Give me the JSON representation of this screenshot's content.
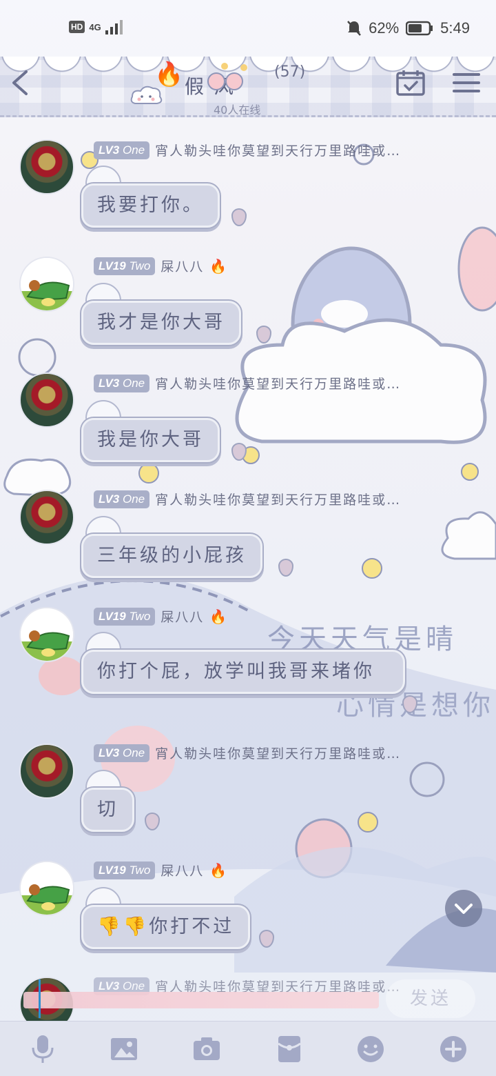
{
  "status_bar": {
    "hd": "HD",
    "network": "4G",
    "battery": "62%",
    "time": "5:49"
  },
  "header": {
    "title": "假 风",
    "member_count": "(57)",
    "online": "40人在线"
  },
  "messages": [
    {
      "level": "LV3",
      "tier": "One",
      "nickname": "宵人勒头哇你莫望到天行万里路哇或…",
      "text": "我要打你。",
      "avatar": "one"
    },
    {
      "level": "LV19",
      "tier": "Two",
      "nickname": "屎八八",
      "text": "我才是你大哥",
      "avatar": "two"
    },
    {
      "level": "LV3",
      "tier": "One",
      "nickname": "宵人勒头哇你莫望到天行万里路哇或…",
      "text": "我是你大哥",
      "avatar": "one"
    },
    {
      "level": "LV3",
      "tier": "One",
      "nickname": "宵人勒头哇你莫望到天行万里路哇或…",
      "text": "三年级的小屁孩",
      "avatar": "one"
    },
    {
      "level": "LV19",
      "tier": "Two",
      "nickname": "屎八八",
      "text": "你打个屁，放学叫我哥来堵你",
      "avatar": "two"
    },
    {
      "level": "LV3",
      "tier": "One",
      "nickname": "宵人勒头哇你莫望到天行万里路哇或…",
      "text": "切",
      "avatar": "one"
    },
    {
      "level": "LV19",
      "tier": "Two",
      "nickname": "屎八八",
      "text": "👎👎你打不过",
      "avatar": "two"
    },
    {
      "level": "LV3",
      "tier": "One",
      "nickname": "宵人勒头哇你莫望到天行万里路哇或…",
      "text": "",
      "avatar": "one"
    }
  ],
  "input": {
    "send_label": "发送"
  },
  "toolbar": {
    "items": [
      "microphone-icon",
      "image-icon",
      "camera-icon",
      "red-packet-icon",
      "emoji-icon",
      "plus-icon"
    ]
  },
  "background_text": {
    "line1": "今天天气是晴",
    "line2": "心情是想你"
  },
  "colors": {
    "bubble": "#d3d6e5",
    "level_tag": "#a9afc8",
    "text": "#5e6380",
    "toolbar": "#e1e4ef"
  }
}
